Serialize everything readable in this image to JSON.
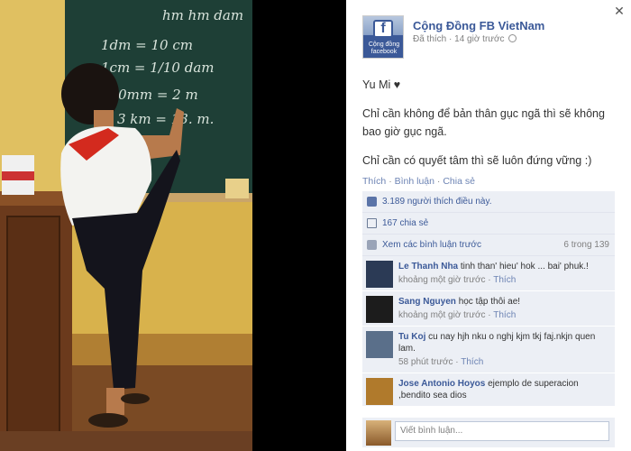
{
  "window": {
    "close_icon": "close-icon"
  },
  "photo": {
    "board_lines": [
      "hm hm dam",
      "1dm = 10   cm",
      "1cm =  1/10  dam",
      "100mm = 2   m",
      "3 km = 13.   m."
    ]
  },
  "post": {
    "page_name": "Cộng Đồng FB VietNam",
    "avatar_letter": "f",
    "avatar_text": "Cộng đồng facebook",
    "liked_label": "Đã thích",
    "time": "14 giờ trước",
    "caption": [
      "Yu Mi ♥",
      "Chỉ cần không để bản thân gục ngã thì sẽ không bao giờ gục ngã.",
      "Chỉ cần có quyết tâm thì sẽ luôn đứng vững :)"
    ],
    "actions": {
      "like": "Thích",
      "comment": "Bình luận",
      "share": "Chia sẻ",
      "separator": "·"
    }
  },
  "ufi": {
    "likes_text": "3.189 người thích điều này.",
    "shares_text": "167 chia sẻ",
    "view_previous": "Xem các bình luận trước",
    "comment_count": "6 trong 139",
    "comments": [
      {
        "author": "Le Thanh Nha",
        "text": "tinh than' hieu' hok ... bai' phuk.!",
        "time": "khoảng một giờ trước",
        "like": "Thích",
        "avatar_color": "#2b3a55"
      },
      {
        "author": "Sang Nguyen",
        "text": "học tập thôi ae!",
        "time": "khoảng một giờ trước",
        "like": "Thích",
        "avatar_color": "#1c1c1c"
      },
      {
        "author": "Tu Koj",
        "text": "cu nay hjh nku o nghj kjm tkj faj.nkjn quen lam.",
        "time": "58 phút trước",
        "like": "Thích",
        "avatar_color": "#5a6f8a"
      },
      {
        "author": "Jose Antonio Hoyos",
        "text": "ejemplo de superacion ,bendito sea dios",
        "time": "",
        "like": "",
        "avatar_color": "#b07a2c"
      }
    ],
    "reply_placeholder": "Viết bình luận..."
  }
}
